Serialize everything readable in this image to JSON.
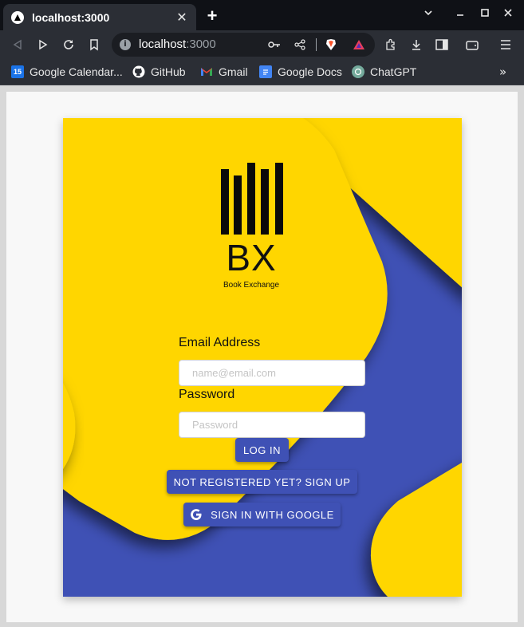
{
  "browser": {
    "tab_title": "localhost:3000",
    "tab_close": "✕",
    "new_tab": "+",
    "url_host": "localhost",
    "url_port": ":3000",
    "bookmarks": [
      {
        "label": "Google Calendar...",
        "icon": "calendar-icon",
        "icon_text": "15",
        "color": "#1a73e8"
      },
      {
        "label": "GitHub",
        "icon": "github-icon",
        "color": "#ffffff"
      },
      {
        "label": "Gmail",
        "icon": "gmail-icon",
        "color": "#ea4335"
      },
      {
        "label": "Google Docs",
        "icon": "docs-icon",
        "color": "#4285f4"
      },
      {
        "label": "ChatGPT",
        "icon": "chatgpt-icon",
        "color": "#74aa9c"
      }
    ],
    "more_bookmarks": "»"
  },
  "login": {
    "logo_text": "BX",
    "logo_subtitle": "Book Exchange",
    "email_label": "Email Address",
    "email_placeholder": "name@email.com",
    "email_value": "",
    "password_label": "Password",
    "password_placeholder": "Password",
    "password_value": "",
    "login_button": "LOG IN",
    "signup_button": "NOT REGISTERED YET? SIGN UP",
    "google_button": "SIGN IN WITH GOOGLE"
  },
  "colors": {
    "primary": "#3f51b5",
    "accent_yellow": "#ffd600",
    "chrome_dark": "#2b2e35"
  }
}
